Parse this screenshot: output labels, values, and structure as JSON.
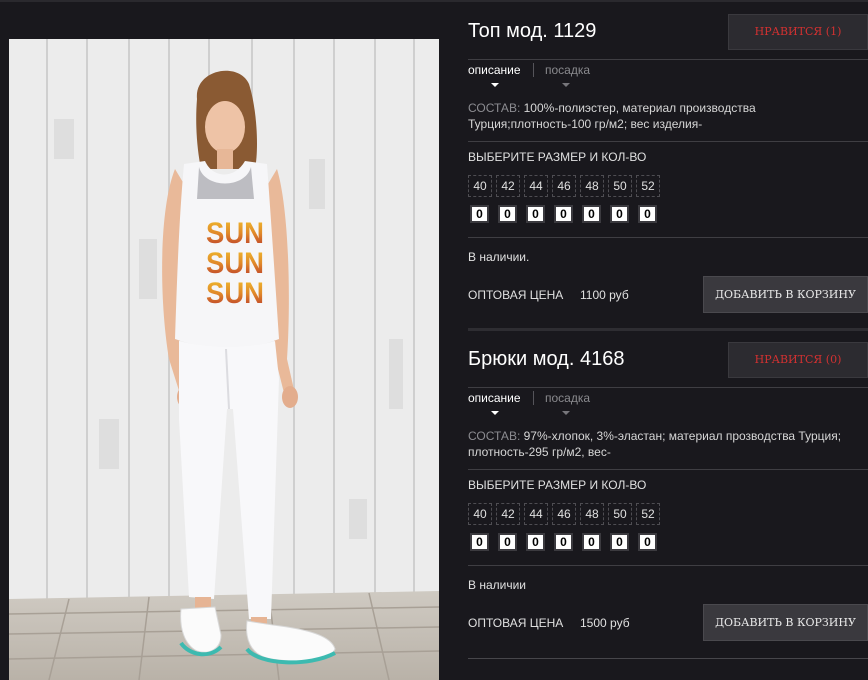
{
  "products": [
    {
      "title": "Топ мод. 1129",
      "like_label": "НРАВИТСЯ (1)",
      "tab_active": "описание",
      "tab_inactive": "посадка",
      "composition_label": "СОСТАВ:",
      "composition_line1": "100%-полиэстер, материал производства",
      "composition_line2": "Турция;плотность-100 гр/м2; вес изделия-",
      "size_header": "ВЫБЕРИТЕ РАЗМЕР И КОЛ-ВО",
      "sizes": [
        "40",
        "42",
        "44",
        "46",
        "48",
        "50",
        "52"
      ],
      "qty": [
        "0",
        "0",
        "0",
        "0",
        "0",
        "0",
        "0"
      ],
      "stock": "В наличии.",
      "price_label": "ОПТОВАЯ ЦЕНА",
      "price": "1100 руб",
      "cart_label": "ДОБАВИТЬ В КОРЗИНУ"
    },
    {
      "title": "Брюки мод. 4168",
      "like_label": "НРАВИТСЯ (0)",
      "tab_active": "описание",
      "tab_inactive": "посадка",
      "composition_label": "СОСТАВ:",
      "composition_line1": "97%-хлопок, 3%-эластан; материал прозводства Турция;",
      "composition_line2": "плотность-295 гр/м2, вес-",
      "size_header": "ВЫБЕРИТЕ РАЗМЕР И КОЛ-ВО",
      "sizes": [
        "40",
        "42",
        "44",
        "46",
        "48",
        "50",
        "52"
      ],
      "qty": [
        "0",
        "0",
        "0",
        "0",
        "0",
        "0",
        "0"
      ],
      "stock": "В наличии",
      "price_label": "ОПТОВАЯ ЦЕНА",
      "price": "1500 руб",
      "cart_label": "ДОБАВИТЬ В КОРЗИНУ"
    }
  ],
  "photo": {
    "shirt_text": [
      "SUN",
      "SUN",
      "SUN"
    ]
  },
  "colors": {
    "background": "#19181d",
    "like_text": "#d23131",
    "button_bg": "#3a393e"
  }
}
